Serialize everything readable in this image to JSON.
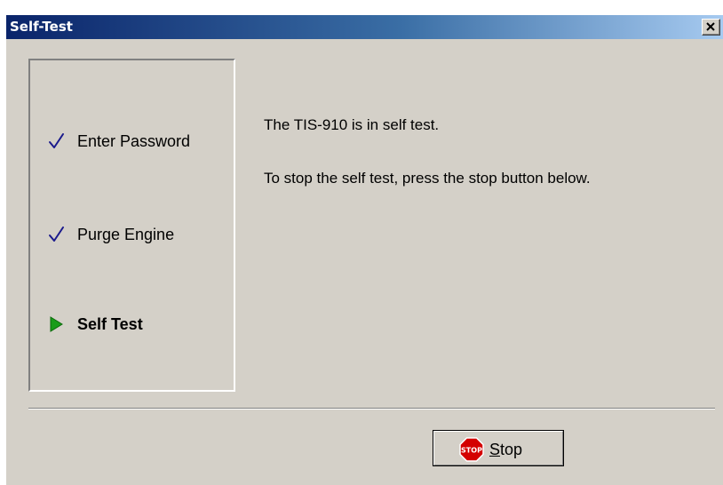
{
  "window": {
    "title": "Self-Test",
    "close_label": "Close"
  },
  "steps": [
    {
      "label": "Enter Password",
      "state": "done",
      "icon": "checkmark-icon"
    },
    {
      "label": "Purge Engine",
      "state": "done",
      "icon": "checkmark-icon"
    },
    {
      "label": "Self Test",
      "state": "current",
      "icon": "current-step-arrow-icon"
    }
  ],
  "message": {
    "line1": "The TIS-910 is in self test.",
    "line2": "To stop the self test, press the stop button below."
  },
  "stop_button": {
    "mnemonic": "S",
    "label_rest": "top",
    "icon": "stop-sign-icon",
    "icon_text": "STOP"
  },
  "colors": {
    "titlebar_start": "#0a246a",
    "titlebar_end": "#a6caf0",
    "dialog_bg": "#d4d0c8",
    "checkmark": "#1a1a8c",
    "current_arrow": "#1a9c1a",
    "stop_sign": "#d40000"
  }
}
